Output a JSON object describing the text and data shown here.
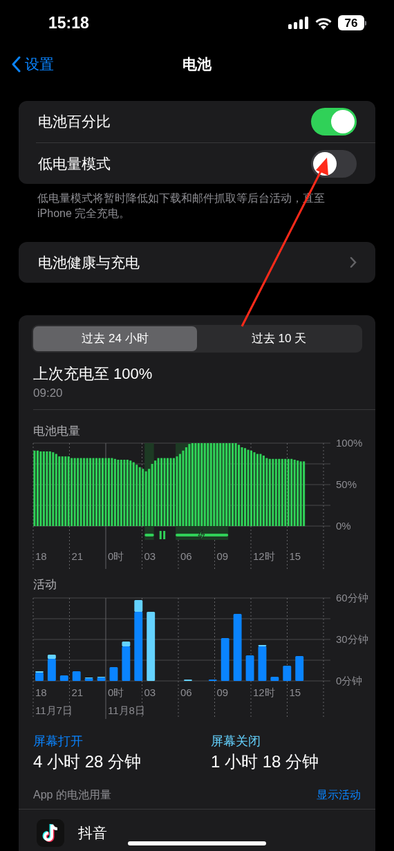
{
  "status_bar": {
    "time": "15:18",
    "battery": "76"
  },
  "nav": {
    "back": "设置",
    "title": "电池"
  },
  "toggles": [
    {
      "label": "电池百分比",
      "on": true
    },
    {
      "label": "低电量模式",
      "on": false
    }
  ],
  "toggles_footer": "低电量模式将暂时降低如下载和邮件抓取等后台活动，直至 iPhone 完全充电。",
  "health_row": {
    "label": "电池健康与充电"
  },
  "segments": [
    {
      "label": "过去 24 小时",
      "selected": true
    },
    {
      "label": "过去 10 天",
      "selected": false
    }
  ],
  "last_charge": {
    "title": "上次充电至 100%",
    "time": "09:20"
  },
  "battery_chart": {
    "title": "电池电量",
    "x_labels": [
      "18",
      "21",
      "0时",
      "03",
      "06",
      "09",
      "12时",
      "15"
    ],
    "chart_data": {
      "type": "bar",
      "grid": true,
      "ylim": [
        0,
        100
      ],
      "yticks": [
        {
          "value": 0,
          "label": "0%"
        },
        {
          "value": 50,
          "label": "50%"
        },
        {
          "value": 100,
          "label": "100%"
        }
      ],
      "series": [
        {
          "color": "#30d158",
          "values": [
            91,
            91,
            90,
            90,
            90,
            90,
            89,
            87,
            84,
            84,
            84,
            84,
            82,
            82,
            82,
            82,
            82,
            82,
            82,
            82,
            82,
            82,
            82,
            82,
            82,
            82,
            81,
            80,
            80,
            80,
            80,
            79,
            77,
            74,
            71,
            69,
            66,
            69,
            75,
            79,
            82,
            82,
            82,
            82,
            82,
            82,
            84,
            87,
            91,
            95,
            99,
            100,
            100,
            100,
            100,
            100,
            100,
            100,
            100,
            100,
            100,
            100,
            100,
            100,
            100,
            100,
            98,
            95,
            94,
            92,
            91,
            89,
            87,
            87,
            85,
            82,
            81,
            81,
            81,
            81,
            81,
            81,
            81,
            81,
            80,
            79,
            78,
            78
          ]
        }
      ]
    }
  },
  "activity_chart": {
    "title": "活动",
    "x_labels": [
      "18",
      "21",
      "0时",
      "03",
      "06",
      "09",
      "12时",
      "15"
    ],
    "date_labels": [
      "11月7日",
      "11月8日"
    ],
    "chart_data": {
      "type": "bar",
      "stacked": true,
      "grid": true,
      "ylim": [
        0,
        60
      ],
      "yticks": [
        {
          "value": 0,
          "label": "0分钟"
        },
        {
          "value": 30,
          "label": "30分钟"
        },
        {
          "value": 60,
          "label": "60分钟"
        }
      ],
      "series": [
        {
          "color": "#0a84ff",
          "values": [
            6,
            16,
            4,
            7,
            2,
            2.5,
            10,
            25,
            50,
            0,
            0,
            0,
            0,
            0,
            1,
            31,
            48.5,
            18.5,
            25,
            3,
            11,
            18,
            null,
            null
          ]
        },
        {
          "color": "#64d2ff",
          "values": [
            1,
            3,
            0,
            0,
            0.5,
            0.5,
            0,
            3.5,
            8.5,
            50,
            0,
            0,
            1,
            0,
            0,
            0,
            0,
            0,
            1,
            0,
            0,
            0,
            null,
            null
          ]
        }
      ]
    }
  },
  "screen_stats": [
    {
      "label": "屏幕打开",
      "value": "4 小时 28 分钟",
      "color": "#0a84ff"
    },
    {
      "label": "屏幕关闭",
      "value": "1 小时 18 分钟",
      "color": "#64d2ff"
    }
  ],
  "app_usage": {
    "title": "App 的电池用量",
    "action": "显示活动",
    "apps": [
      {
        "name": "抖音"
      }
    ]
  }
}
